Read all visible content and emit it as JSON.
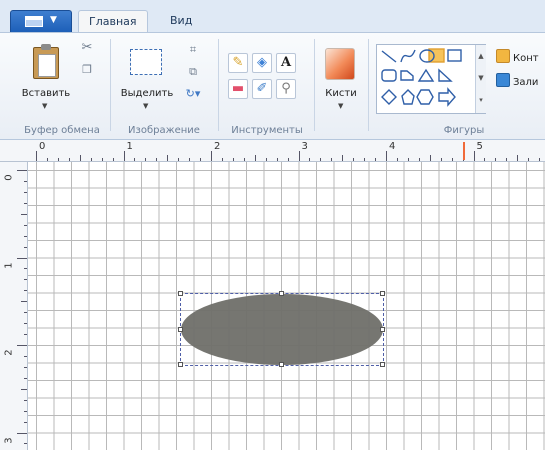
{
  "tabs": {
    "home": "Главная",
    "view": "Вид"
  },
  "ribbon": {
    "clipboard": {
      "paste_label": "Вставить",
      "group_label": "Буфер обмена"
    },
    "image": {
      "select_label": "Выделить",
      "group_label": "Изображение"
    },
    "tools": {
      "group_label": "Инструменты",
      "text_tool": "A"
    },
    "brushes": {
      "label": "Кисти"
    },
    "shapes": {
      "group_label": "Фигуры",
      "outline_label": "Конт",
      "fill_label": "Зали"
    }
  },
  "ruler": {
    "h_labels": [
      "0",
      "1",
      "2",
      "3",
      "4",
      "5"
    ],
    "v_labels": [
      "0",
      "1",
      "2",
      "3"
    ]
  },
  "colors": {
    "ellipse_fill": "#6f6f69",
    "accent": "#1d5fb8",
    "marker": "#f06a3a"
  }
}
